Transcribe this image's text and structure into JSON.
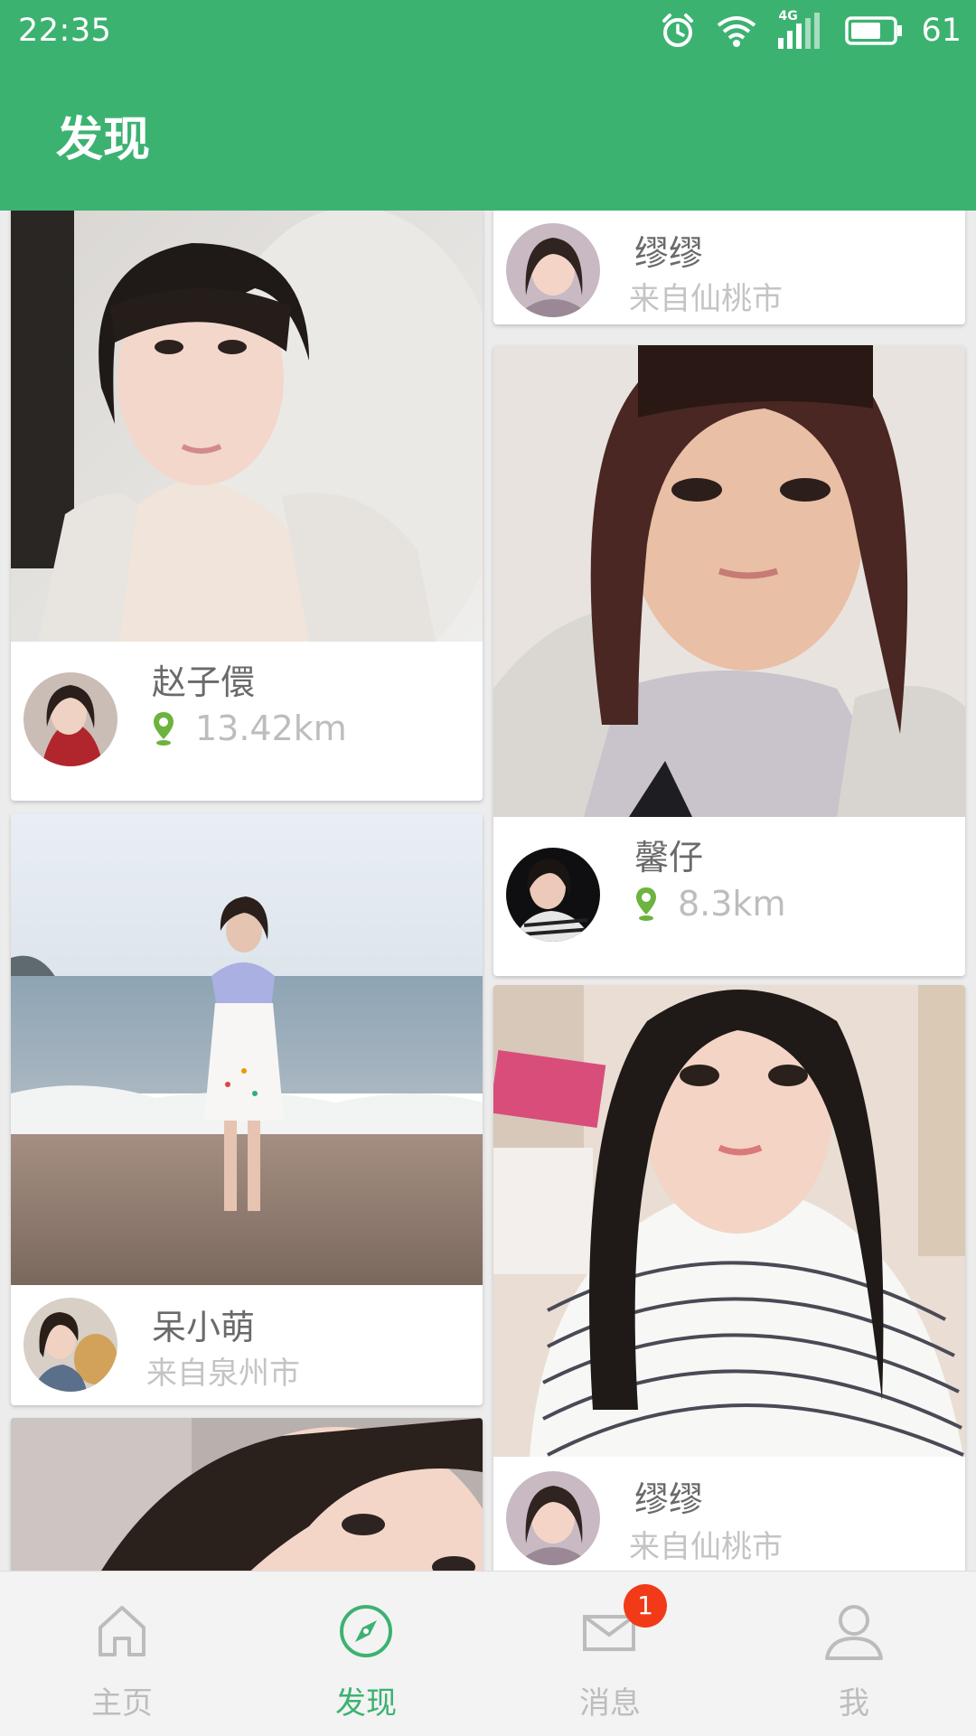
{
  "status_bar": {
    "time": "22:35",
    "network": "4G",
    "battery": "61"
  },
  "header": {
    "title": "发现"
  },
  "cards": [
    {
      "name": "赵子儇",
      "distance": "13.42km"
    },
    {
      "name": "呆小萌",
      "location": "来自泉州市"
    },
    {
      "name": "缪缪",
      "location": "来自仙桃市"
    },
    {
      "name": "馨仔",
      "distance": "8.3km"
    },
    {
      "name": "缪缪",
      "location": "来自仙桃市"
    }
  ],
  "nav": {
    "items": [
      {
        "label": "主页",
        "icon": "home-icon"
      },
      {
        "label": "发现",
        "icon": "compass-icon"
      },
      {
        "label": "消息",
        "icon": "mail-icon",
        "badge": "1"
      },
      {
        "label": "我",
        "icon": "person-icon"
      }
    ],
    "active": "发现"
  },
  "colors": {
    "primary": "#3cb271",
    "badge": "#f23a18",
    "pin": "#6db33f"
  }
}
